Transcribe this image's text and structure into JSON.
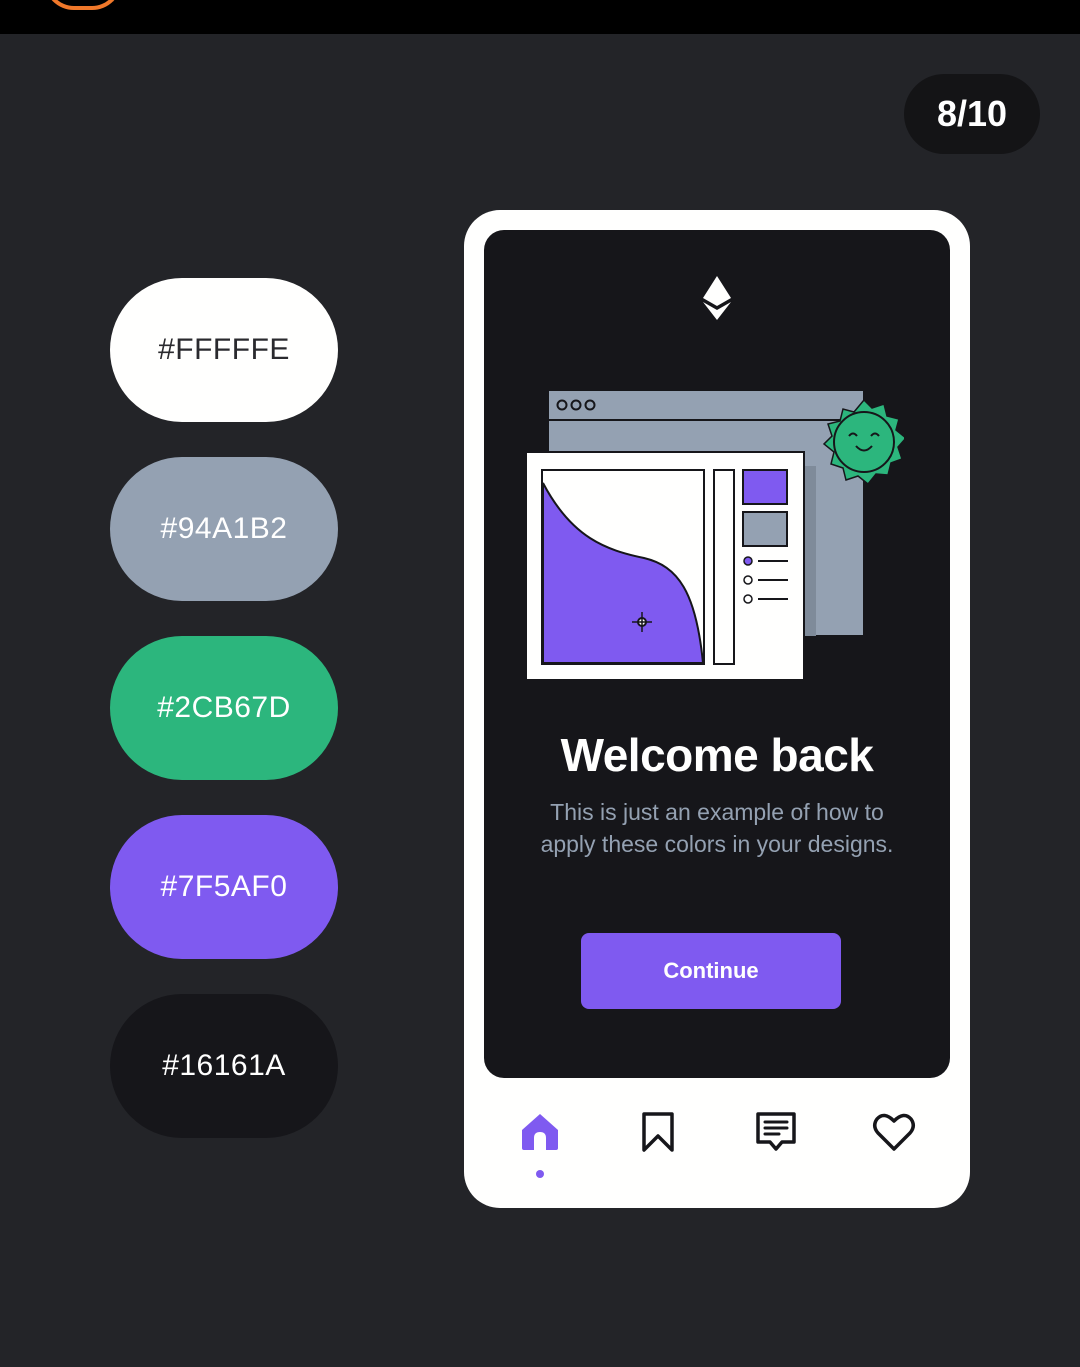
{
  "counter": "8/10",
  "palette": [
    {
      "label": "#FFFFFE",
      "color": "#FFFFFE",
      "text_color": "#2a2a2e"
    },
    {
      "label": "#94A1B2",
      "color": "#94A1B2",
      "text_color": "#ffffff"
    },
    {
      "label": "#2CB67D",
      "color": "#2CB67D",
      "text_color": "#ffffff"
    },
    {
      "label": "#7F5AF0",
      "color": "#7F5AF0",
      "text_color": "#ffffff"
    },
    {
      "label": "#16161A",
      "color": "#16161A",
      "text_color": "#ffffff"
    }
  ],
  "phone": {
    "logo_icon": "ethereum-icon",
    "title": "Welcome back",
    "description": "This is just an example of how to apply these colors in your designs.",
    "button_label": "Continue",
    "nav": [
      {
        "icon": "home-icon",
        "active": true
      },
      {
        "icon": "bookmark-icon",
        "active": false
      },
      {
        "icon": "message-icon",
        "active": false
      },
      {
        "icon": "heart-icon",
        "active": false
      }
    ]
  }
}
